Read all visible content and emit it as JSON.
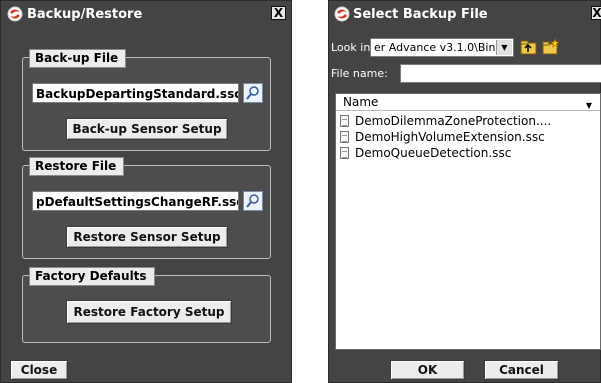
{
  "left_dialog": {
    "title": "Backup/Restore",
    "close_glyph": "X",
    "backup": {
      "legend": "Back-up File",
      "file": "BackupDepartingStandard.ssc",
      "button": "Back-up Sensor Setup"
    },
    "restore": {
      "legend": "Restore File",
      "file": "pDefaultSettingsChangeRF.ssc",
      "button": "Restore Sensor Setup"
    },
    "factory": {
      "legend": "Factory Defaults",
      "button": "Restore Factory Setup"
    },
    "close_button": "Close"
  },
  "right_dialog": {
    "title": "Select Backup File",
    "close_glyph": "X",
    "look_in_label": "Look in:",
    "look_in_value": "er Advance v3.1.0\\Bin",
    "file_name_label": "File name:",
    "file_name_value": "",
    "list_header": "Name",
    "files": [
      "DemoDilemmaZoneProtection....",
      "DemoHighVolumeExtension.ssc",
      "DemoQueueDetection.ssc"
    ],
    "ok_button": "OK",
    "cancel_button": "Cancel"
  },
  "icons": {
    "app": "app-logo-icon",
    "browse": "magnifier-icon",
    "up_folder": "up-folder-icon",
    "new_folder": "new-folder-icon",
    "file": "file-icon"
  },
  "colors": {
    "dialog_bg": "#444444",
    "group_border": "#bdbdbd",
    "button_face": "#ececec"
  }
}
